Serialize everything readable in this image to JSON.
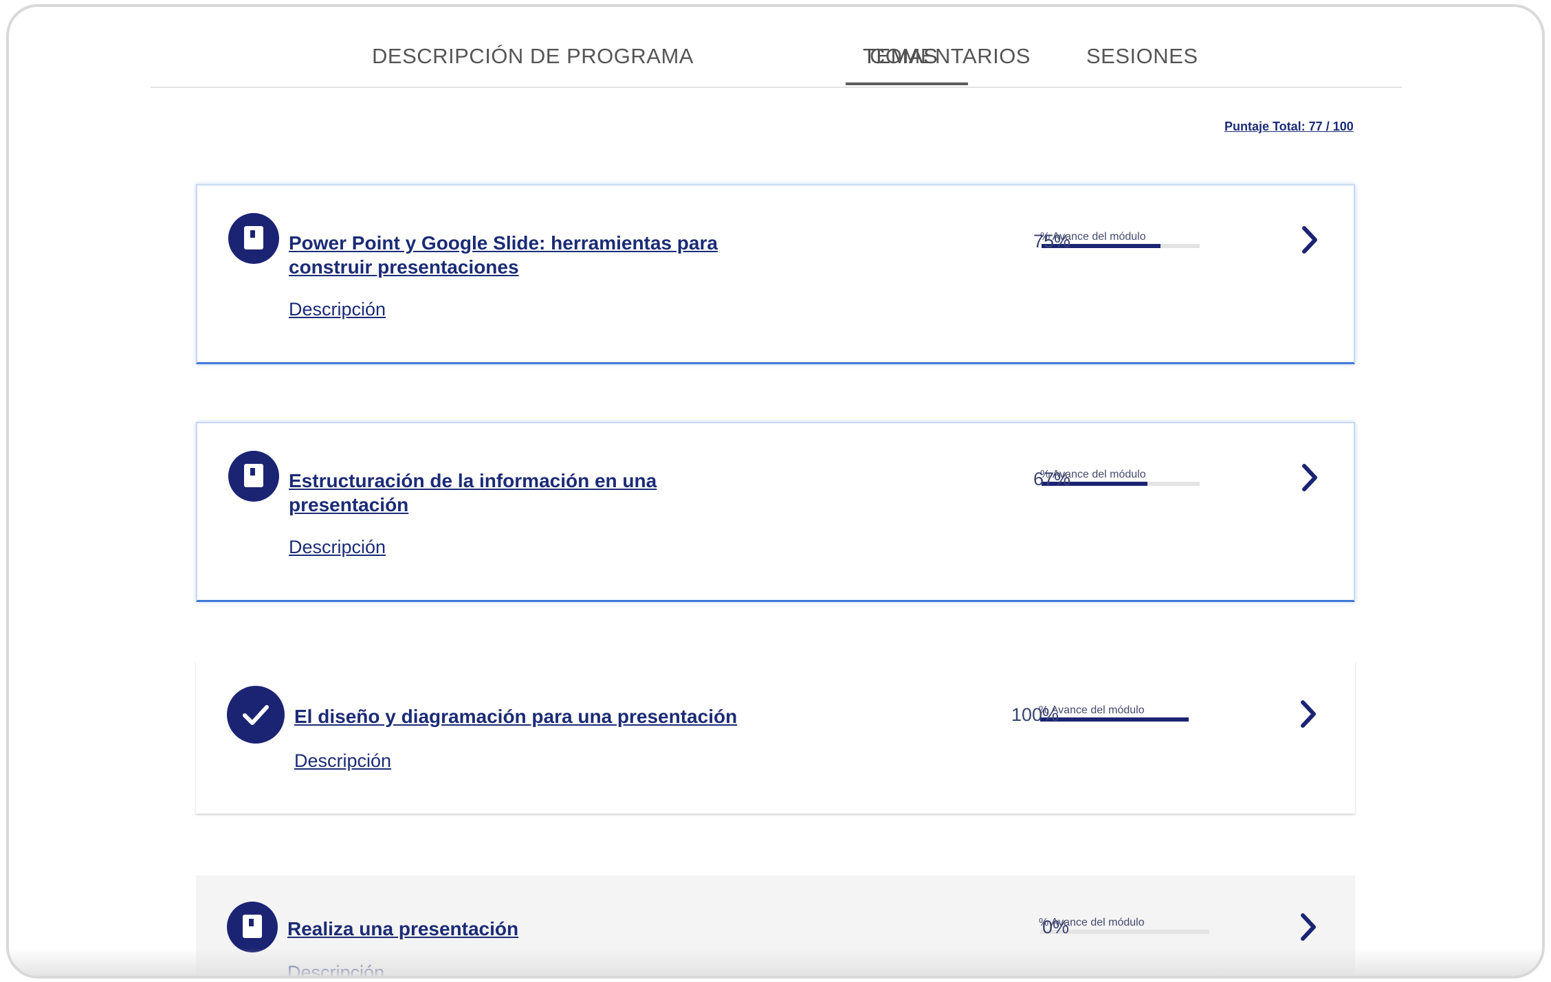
{
  "tabs": [
    {
      "label": "DESCRIPCIÓN DE PROGRAMA"
    },
    {
      "label": "TEMAS"
    },
    {
      "label": "COMENTARIOS"
    },
    {
      "label": "SESIONES"
    }
  ],
  "active_tab": "TEMAS",
  "total_score": "Puntaje Total: 77 / 100",
  "progress_label": "% Avance del módulo",
  "description_label": "Descripción",
  "colors": {
    "primary": "#1b2473",
    "link": "#1b2b75",
    "card_highlight_border": "#3f79d6"
  },
  "modules": [
    {
      "title_line1": "Power Point y Google Slide: herramientas para",
      "title_line2": "construir presentaciones",
      "icon": "book-icon",
      "progress": 0.75,
      "percent": "75%"
    },
    {
      "title_line1": "Estructuración de la información en una",
      "title_line2": "presentación",
      "icon": "book-icon",
      "progress": 0.67,
      "percent": "67%"
    },
    {
      "title_line1": "El diseño y diagramación para una presentación",
      "title_line2": "",
      "icon": "checkmark-icon",
      "progress": 1.0,
      "percent": "100%"
    },
    {
      "title_line1": "Realiza una presentación",
      "title_line2": "",
      "icon": "book-icon",
      "progress": 0.0,
      "percent": "0%"
    }
  ]
}
